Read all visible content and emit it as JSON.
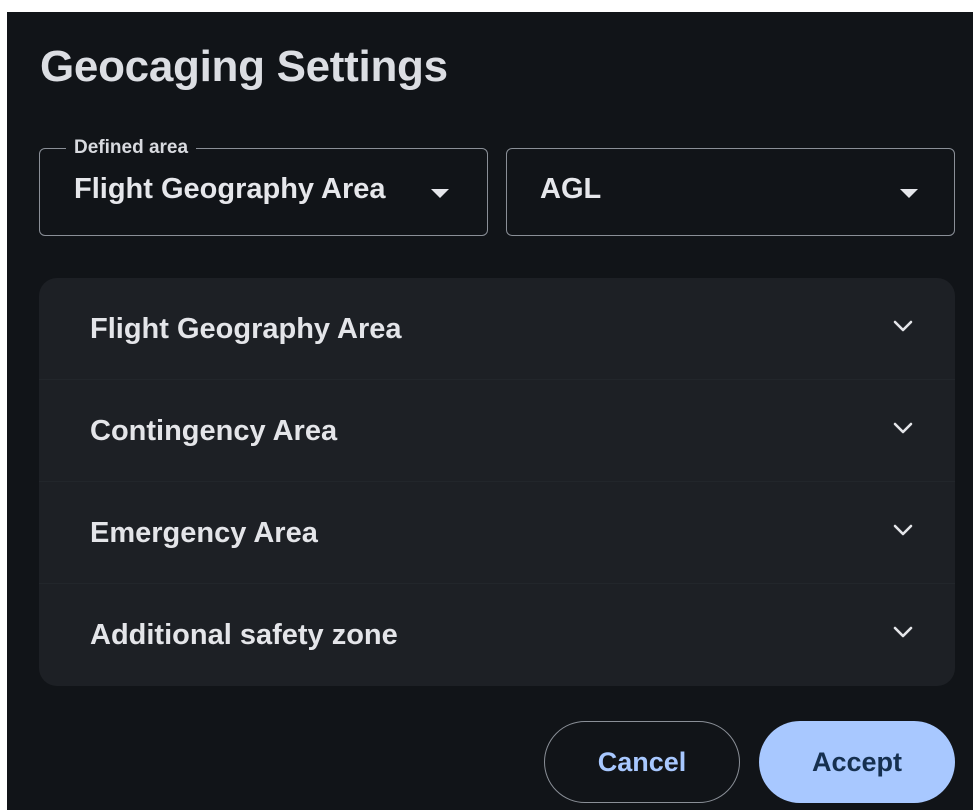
{
  "dialog": {
    "title": "Geocaging Settings"
  },
  "area_select": {
    "legend": "Defined area",
    "value": "Flight Geography Area",
    "icon": "arrow-drop-down-icon"
  },
  "reference_select": {
    "value": "AGL",
    "icon": "arrow-drop-down-icon"
  },
  "accordion": {
    "items": [
      {
        "label": "Flight Geography Area",
        "icon": "chevron-down-icon"
      },
      {
        "label": "Contingency Area",
        "icon": "chevron-down-icon"
      },
      {
        "label": "Emergency Area",
        "icon": "chevron-down-icon"
      },
      {
        "label": "Additional safety zone",
        "icon": "chevron-down-icon"
      }
    ]
  },
  "actions": {
    "cancel_label": "Cancel",
    "accept_label": "Accept"
  },
  "colors": {
    "dialog_background": "#111418",
    "panel_background": "#1d2025",
    "accent": "#a8c8ff",
    "outline": "#8a8f97"
  }
}
